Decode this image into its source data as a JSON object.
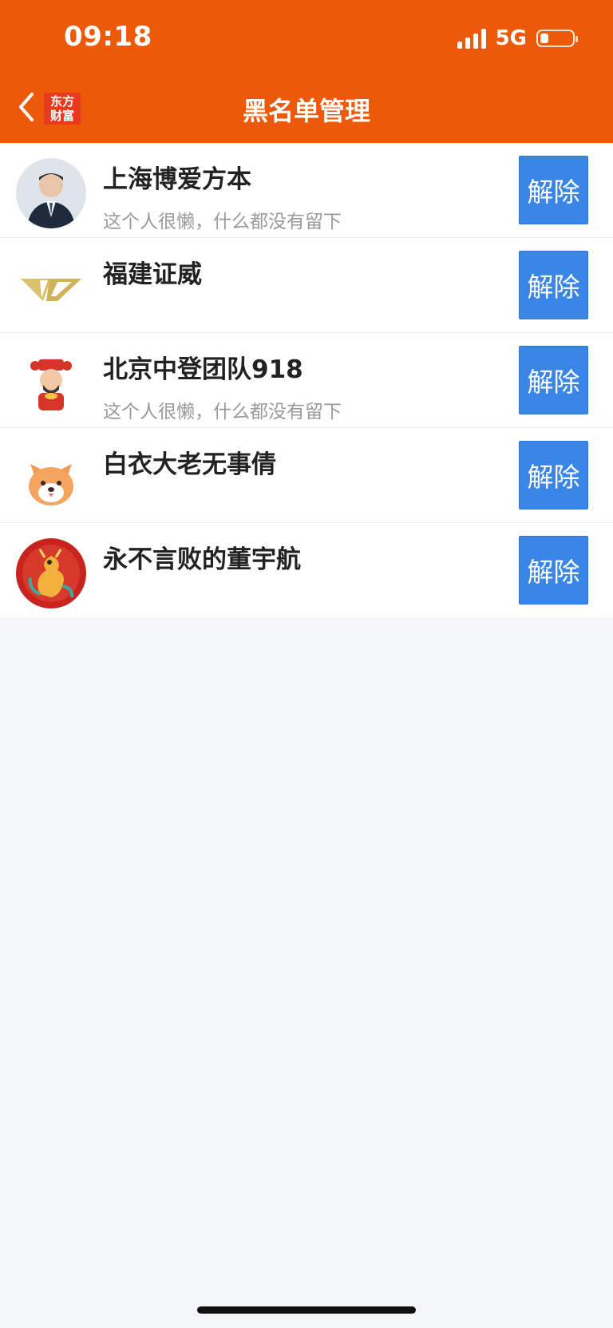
{
  "status": {
    "time": "09:18",
    "network": "5G"
  },
  "nav": {
    "logo_line1": "东方",
    "logo_line2": "财富",
    "title": "黑名单管理"
  },
  "rows": [
    {
      "name": "上海博爱方本",
      "bio": "这个人很懒，什么都没有留下",
      "button": "解除"
    },
    {
      "name": "福建证威",
      "bio": "",
      "button": "解除"
    },
    {
      "name": "北京中登团队918",
      "bio": "这个人很懒，什么都没有留下",
      "button": "解除"
    },
    {
      "name": "白衣大老无事倩",
      "bio": "",
      "button": "解除"
    },
    {
      "name": "永不言败的董宇航",
      "bio": "",
      "button": "解除"
    }
  ],
  "colors": {
    "header": "#ec5a09",
    "button": "#3a86e6",
    "background": "#f5f6f8"
  }
}
